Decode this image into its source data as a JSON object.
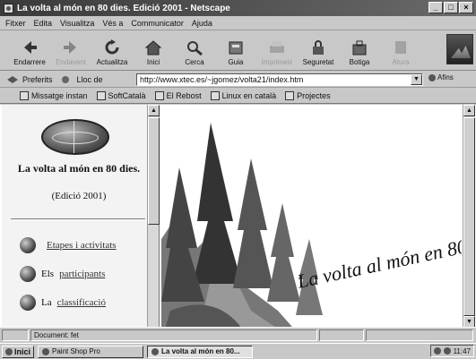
{
  "window": {
    "title": "La volta al món en 80 dies. Edició 2001 - Netscape",
    "min": "_",
    "max": "□",
    "close": "×"
  },
  "menu": [
    "Fitxer",
    "Edita",
    "Visualitza",
    "Vés a",
    "Communicator",
    "Ajuda"
  ],
  "toolbar": [
    {
      "label": "Endarrere",
      "icon": "back-arrow-icon",
      "enabled": true
    },
    {
      "label": "Endavant",
      "icon": "forward-arrow-icon",
      "enabled": false
    },
    {
      "label": "Actualitza",
      "icon": "reload-icon",
      "enabled": true
    },
    {
      "label": "Inici",
      "icon": "home-icon",
      "enabled": true
    },
    {
      "label": "Cerca",
      "icon": "search-icon",
      "enabled": true
    },
    {
      "label": "Guia",
      "icon": "guide-icon",
      "enabled": true
    },
    {
      "label": "Imprimeix",
      "icon": "print-icon",
      "enabled": false
    },
    {
      "label": "Seguretat",
      "icon": "security-lock-icon",
      "enabled": true
    },
    {
      "label": "Botiga",
      "icon": "shop-icon",
      "enabled": true
    },
    {
      "label": "Atura",
      "icon": "stop-icon",
      "enabled": false
    }
  ],
  "location": {
    "bookmarks_label": "Preferits",
    "field_label": "Lloc de",
    "url": "http://www.xtec.es/~jgomez/volta21/index.htm",
    "whats_related": "Afins"
  },
  "personal_toolbar": [
    "Missatge instan",
    "SoftCatalà",
    "El Rebost",
    "Linux en català",
    "Projectes"
  ],
  "left_frame": {
    "title": "La volta al món en 80 dies.",
    "subtitle": "(Edició 2001)",
    "links": [
      {
        "prefix": "",
        "link": "Etapes i activitats"
      },
      {
        "prefix": "Els ",
        "link": "participants"
      },
      {
        "prefix": "La ",
        "link": "classificació"
      }
    ]
  },
  "right_frame": {
    "banner": "La volta al món en 80"
  },
  "status": {
    "text": "Document: fet"
  },
  "taskbar": {
    "start": "Inici",
    "tasks": [
      {
        "label": "Paint Shop Pro",
        "active": false
      },
      {
        "label": "La volta al món en 80...",
        "active": true
      }
    ],
    "clock": "11:47"
  }
}
